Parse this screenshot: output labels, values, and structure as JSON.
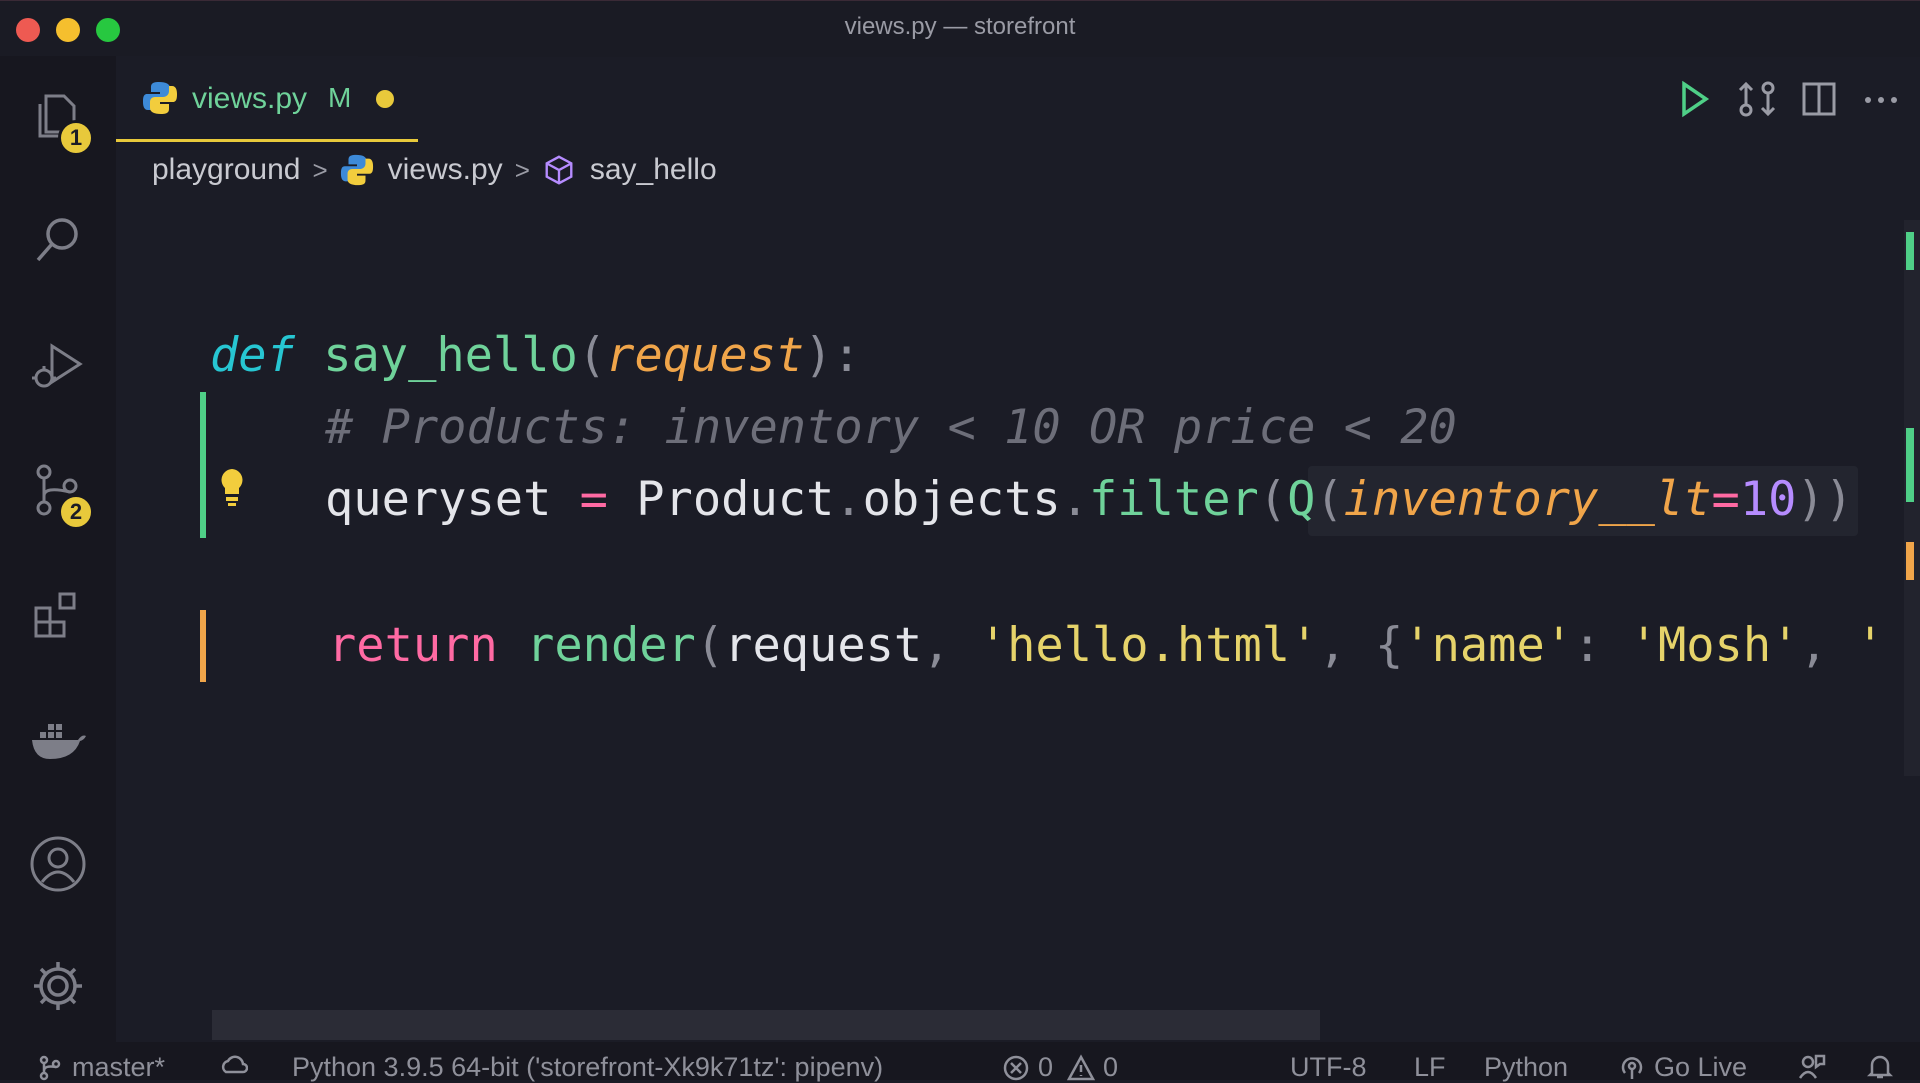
{
  "window": {
    "title": "views.py — storefront"
  },
  "activity_bar": {
    "explorer_badge": "1",
    "source_control_badge": "2"
  },
  "tab": {
    "label": "views.py",
    "modified_flag": "M"
  },
  "breadcrumb": {
    "folder": "playground",
    "file": "views.py",
    "symbol": "say_hello"
  },
  "editor": {
    "line1": {
      "kw": "def",
      "name": "say_hello",
      "open": "(",
      "param": "request",
      "close": "):"
    },
    "line2": {
      "comment": "# Products: inventory < 10 OR price < 20"
    },
    "line3": {
      "var": "queryset",
      "eq": "=",
      "cls": "Product",
      "dot1": ".",
      "attr": "objects",
      "dot2": ".",
      "method": "filter",
      "p1": "(",
      "q": "Q",
      "p2": "(",
      "kwarg": "inventory__lt",
      "eq2": "=",
      "val": "10",
      "p3": ")",
      "p4": ")"
    },
    "line4": {
      "kw": "return",
      "fn": "render",
      "p1": "(",
      "arg1": "request",
      "comma1": ",",
      "str1": "'hello.html'",
      "comma2": ",",
      "brace": "{",
      "key": "'name'",
      "colon": ":",
      "val": "'Mosh'",
      "comma3": ",",
      "tail": "'"
    }
  },
  "status_bar": {
    "branch": "master*",
    "interpreter": "Python 3.9.5 64-bit ('storefront-Xk9k71tz': pipenv)",
    "errors": "0",
    "warnings": "0",
    "encoding": "UTF-8",
    "eol": "LF",
    "language": "Python",
    "go_live": "Go Live"
  },
  "colors": {
    "accent": "#e8c93b",
    "keyword_def": "#27c6d2",
    "function": "#6fd29a",
    "parameter": "#f0a54a",
    "keyword_return": "#ff6aa3",
    "string": "#e6d36a",
    "number": "#b68cff",
    "comment": "#6d6e79"
  },
  "icons": [
    "files-icon",
    "search-icon",
    "run-debug-icon",
    "source-control-icon",
    "extensions-icon",
    "docker-icon",
    "account-icon",
    "settings-icon",
    "python-icon",
    "run-icon",
    "compare-icon",
    "split-editor-icon",
    "more-icon",
    "symbol-method-icon",
    "lightbulb-icon",
    "branch-icon",
    "sync-icon",
    "error-icon",
    "warning-icon",
    "broadcast-icon",
    "feedback-icon",
    "bell-icon"
  ]
}
